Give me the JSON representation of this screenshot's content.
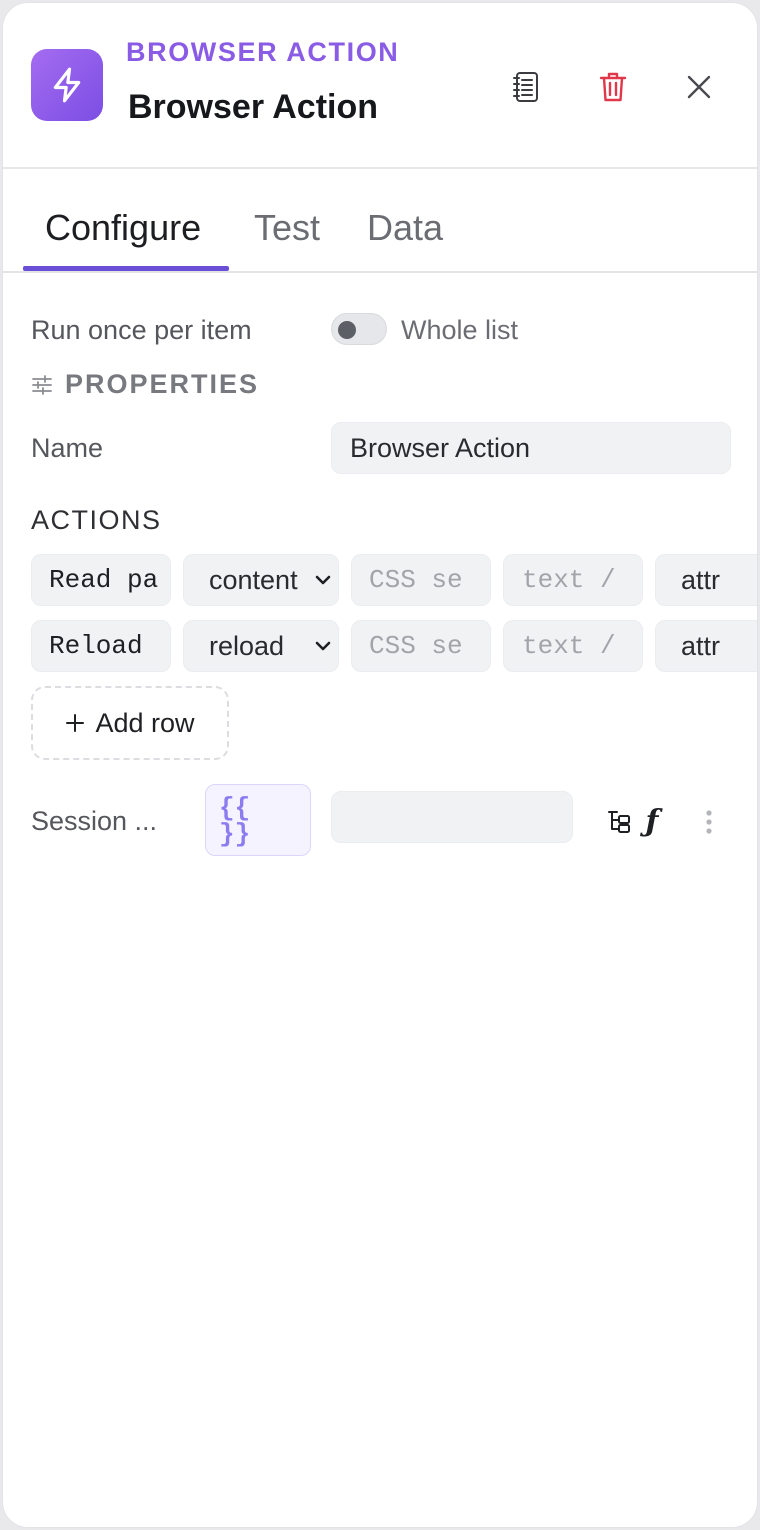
{
  "header": {
    "kicker": "BROWSER ACTION",
    "title": "Browser Action",
    "icons": [
      "lightning-icon",
      "notes-icon",
      "trash-icon",
      "close-icon"
    ],
    "accent": "#8a5ce6"
  },
  "tabs": [
    {
      "label": "Configure",
      "active": true
    },
    {
      "label": "Test",
      "active": false
    },
    {
      "label": "Data",
      "active": false
    }
  ],
  "run_mode": {
    "label": "Run once per item",
    "toggle_label": "Whole list",
    "toggle_on": false
  },
  "properties": {
    "heading": "PROPERTIES",
    "name_label": "Name",
    "name_value": "Browser Action"
  },
  "actions": {
    "heading": "ACTIONS",
    "rows": [
      {
        "action": "Read pa",
        "type": "content",
        "selector_placeholder": "CSS se",
        "value_placeholder": "text /",
        "attr": "attr"
      },
      {
        "action": "Reload",
        "type": "reload",
        "selector_placeholder": "CSS se",
        "value_placeholder": "text /",
        "attr": "attr"
      }
    ],
    "add_row_label": "Add row"
  },
  "session": {
    "label": "Session ...",
    "expr_line1": "{{",
    "expr_line2": "}}",
    "value": "",
    "fx_label": "ƒ"
  }
}
